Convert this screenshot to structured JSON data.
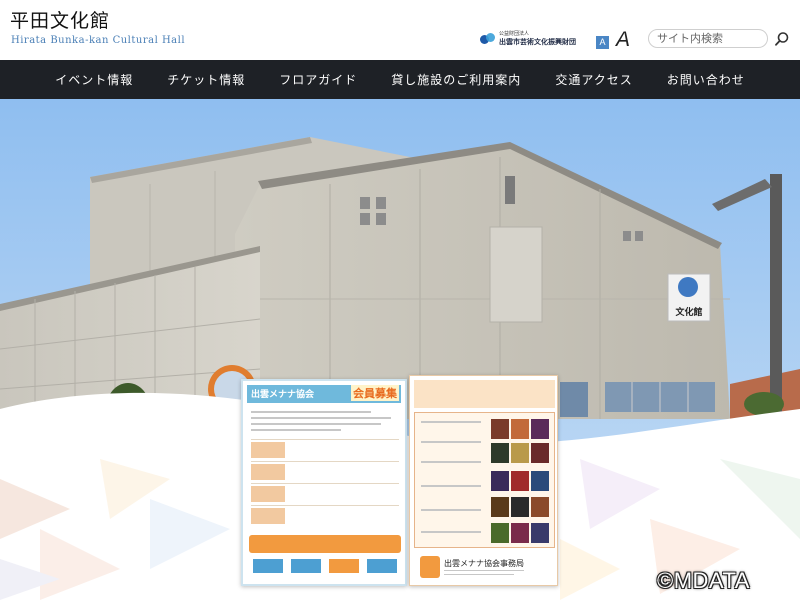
{
  "header": {
    "site_title": "平田文化館",
    "site_subtitle": "Hirata Bunka-kan Cultural Hall",
    "foundation_small": "公益財団法人",
    "foundation_name": "出雲市芸術文化振興財団",
    "font_small_label": "A",
    "font_large_label": "A",
    "search_placeholder": "サイト内検索",
    "search_icon": "search-icon"
  },
  "nav": {
    "items": [
      {
        "label": "イベント情報"
      },
      {
        "label": "チケット情報"
      },
      {
        "label": "フロアガイド"
      },
      {
        "label": "貸し施設のご利用案内"
      },
      {
        "label": "交通アクセス"
      },
      {
        "label": "お問い合わせ"
      }
    ]
  },
  "hero": {
    "building_sign": "文化館",
    "flyer_left_title": "出雲メナナ協会",
    "flyer_left_recruit": "会員募集",
    "flyer_right_footer": "出雲メナナ協会事務局"
  },
  "copyright": "©MDATA",
  "colors": {
    "nav_bg": "#1e2126",
    "accent_blue": "#4a86c5",
    "subtitle_blue": "#4a7fb6"
  }
}
